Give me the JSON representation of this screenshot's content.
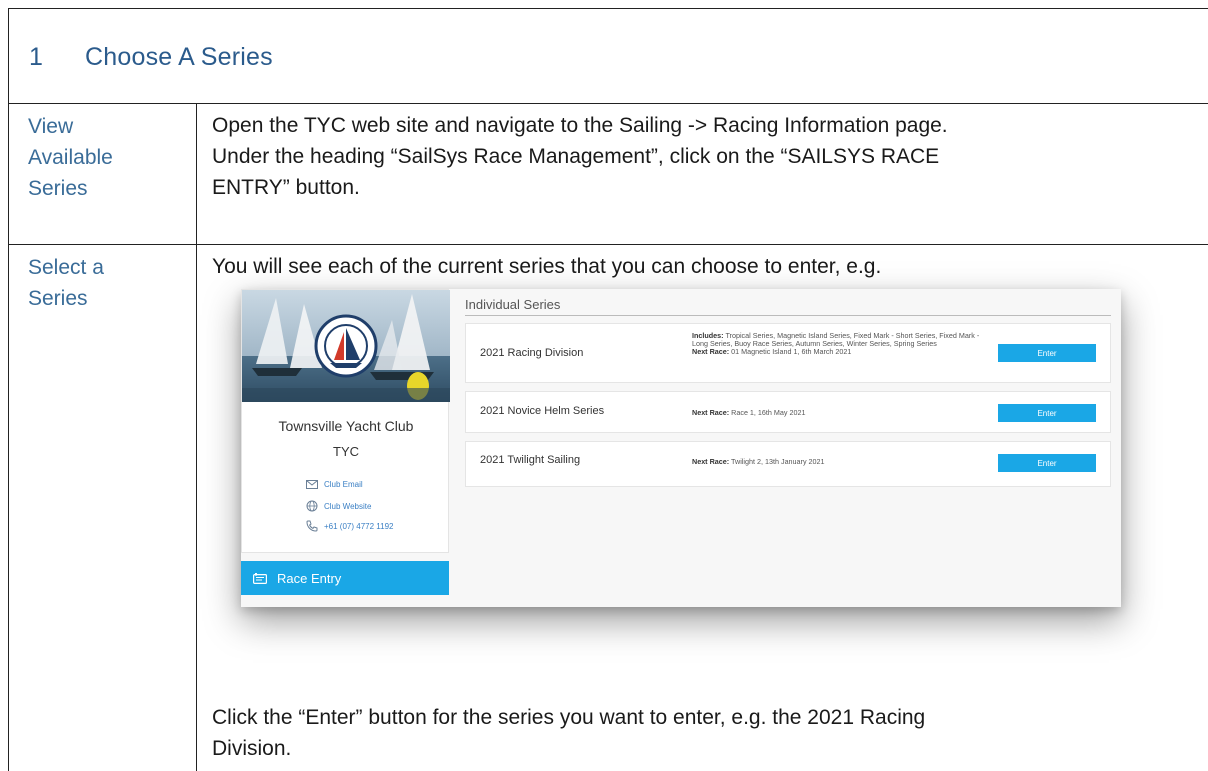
{
  "section": {
    "number": "1",
    "title": "Choose A Series"
  },
  "rows": [
    {
      "label": [
        "View",
        "Available",
        "Series"
      ],
      "text": [
        "Open the TYC web site and navigate to the Sailing -> Racing Information page.",
        "Under the heading “SailSys Race Management”, click on the “SAILSYS RACE",
        "ENTRY” button."
      ]
    },
    {
      "label": [
        "Select a",
        "Series"
      ],
      "intro": "You will see each of the current series that you can choose to enter, e.g.",
      "outro": [
        "Click the “Enter” button for the series you want to enter, e.g. the 2021 Racing",
        "Division."
      ]
    }
  ],
  "screenshot": {
    "club": {
      "name": "Townsville Yacht Club",
      "abbr": "TYC",
      "email_label": "Club Email",
      "website_label": "Club Website",
      "phone": "+61 (07) 4772 1192"
    },
    "race_entry_label": "Race Entry",
    "heading": "Individual Series",
    "series": [
      {
        "name": "2021 Racing Division",
        "includes_label": "Includes:",
        "includes": "Tropical Series, Magnetic Island Series, Fixed Mark - Short Series, Fixed Mark - Long Series, Buoy Race Series, Autumn Series, Winter Series, Spring Series",
        "next_label": "Next Race:",
        "next": "01 Magnetic Island 1, 6th March 2021",
        "button": "Enter"
      },
      {
        "name": "2021 Novice Helm Series",
        "next_label": "Next Race:",
        "next": "Race 1, 16th May 2021",
        "button": "Enter"
      },
      {
        "name": "2021 Twilight Sailing",
        "next_label": "Next Race:",
        "next": "Twilight 2, 13th January 2021",
        "button": "Enter"
      }
    ],
    "colors": {
      "accent": "#1aa7e6",
      "link": "#3a7fc4",
      "heading_blue": "#2b5b8c"
    }
  }
}
